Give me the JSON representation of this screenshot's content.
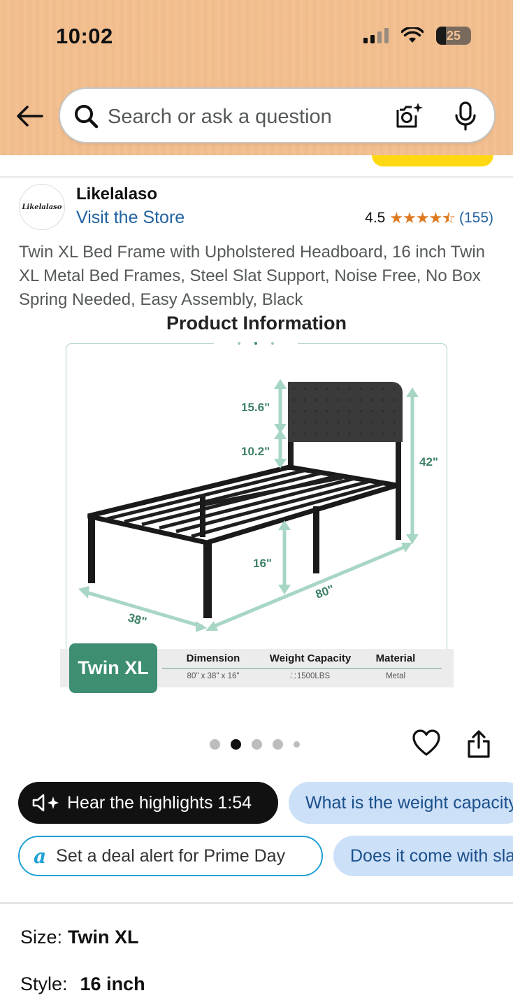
{
  "status_bar": {
    "time": "10:02",
    "battery": "25"
  },
  "search": {
    "placeholder": "Search or ask a question"
  },
  "brand": {
    "logo_text": "Likelalaso",
    "name": "Likelalaso",
    "visit_store": "Visit the Store"
  },
  "rating": {
    "value": "4.5",
    "stars": 4.5,
    "count": "(155)"
  },
  "product": {
    "title": "Twin XL Bed Frame with Upholstered Headboard, 16 inch Twin XL Metal Bed Frames, Steel Slat Support, Noise Free, No Box Spring Needed, Easy Assembly, Black"
  },
  "image": {
    "heading": "Product Information",
    "dims": {
      "headboard_top": "15.6\"",
      "headboard_gap": "10.2\"",
      "total_height": "42\"",
      "clearance": "16\"",
      "length": "80\"",
      "width": "38\""
    },
    "badge": "Twin XL",
    "specs": [
      {
        "label": "Dimension",
        "value": "80\" x 38\" x 16\""
      },
      {
        "label": "Weight Capacity",
        "value": "1500LBS"
      },
      {
        "label": "Material",
        "value": "Metal"
      }
    ],
    "carousel": {
      "count": 5,
      "active_index": 1
    }
  },
  "chips": {
    "hear": "Hear the highlights 1:54",
    "question_1": "What is the weight capacity?",
    "deal_alert": "Set a deal alert for Prime Day",
    "question_2": "Does it come with slats?"
  },
  "options": {
    "size_label": "Size:",
    "size_value": "Twin XL",
    "style_label": "Style:",
    "style_value": "16 inch"
  },
  "colors": {
    "accent_green": "#3e8f72",
    "link_blue": "#2162a1",
    "star_orange": "#de7921",
    "header_bg": "#f3c193"
  }
}
